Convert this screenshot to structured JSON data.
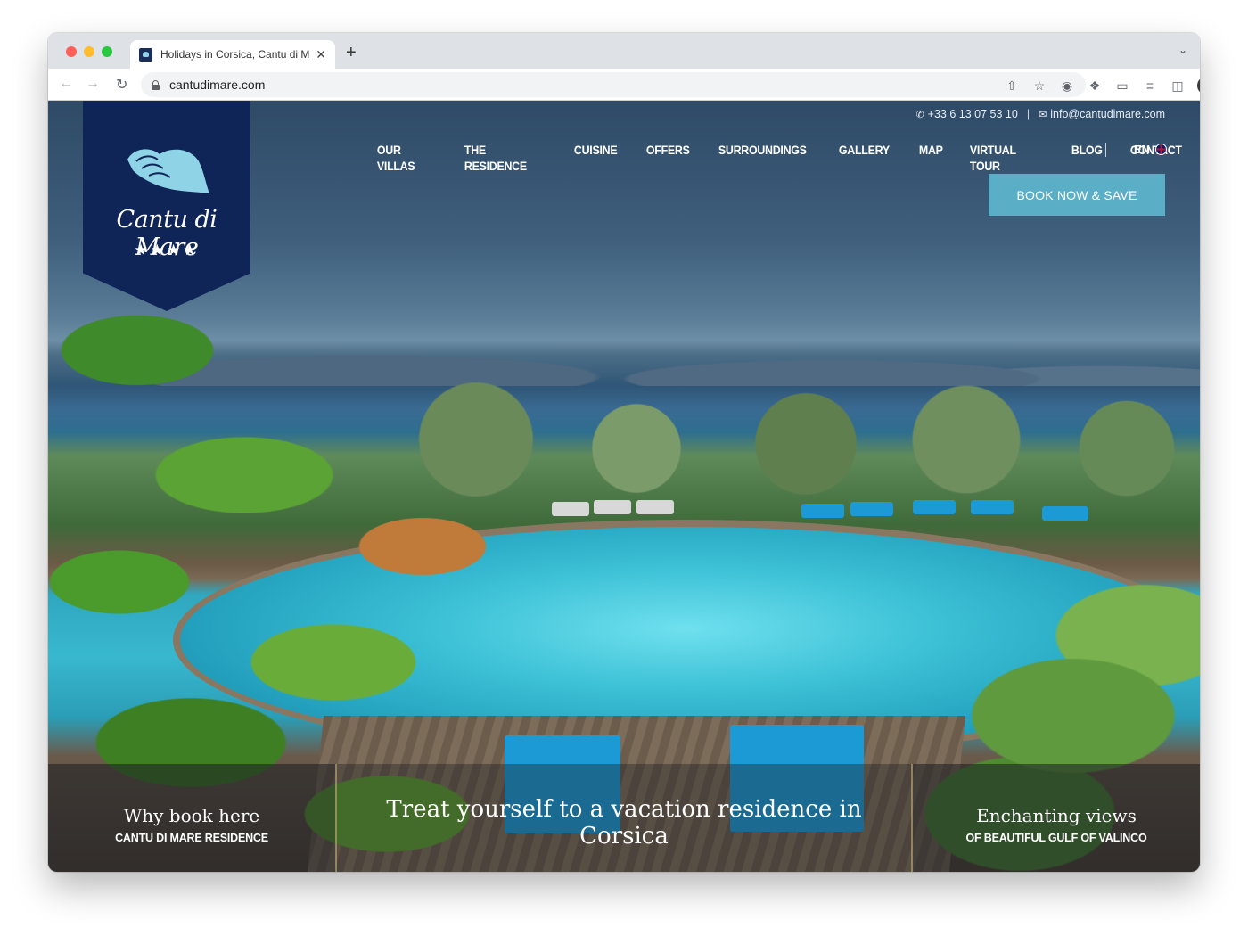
{
  "browser": {
    "tab_title": "Holidays in Corsica, Cantu di M",
    "tab_close": "✕",
    "new_tab": "+",
    "url": "cantudimare.com",
    "colors": {
      "tabstrip": "#dee1e6",
      "red": "#ff5f57",
      "yellow": "#febc2e",
      "green": "#28c840"
    }
  },
  "site": {
    "brand": {
      "name": "Cantu di Mare",
      "stars": "★★★★",
      "color": "#0f2557"
    },
    "contact": {
      "phone": "+33 6 13 07 53 10",
      "separator": "|",
      "email": "info@cantudimare.com"
    },
    "nav": [
      {
        "label": "OUR VILLAS"
      },
      {
        "label": "THE RESIDENCE"
      },
      {
        "label": "CUISINE"
      },
      {
        "label": "OFFERS"
      },
      {
        "label": "SURROUNDINGS"
      },
      {
        "label": "GALLERY"
      },
      {
        "label": "MAP"
      },
      {
        "label": "VIRTUAL TOUR"
      },
      {
        "label": "BLOG"
      },
      {
        "label": "CONTACT"
      }
    ],
    "language": "EN",
    "book_button": {
      "label": "BOOK NOW & SAVE",
      "color": "#5aaec6"
    },
    "panels": {
      "left": {
        "title": "Why book here",
        "subtitle": "CANTU DI MARE RESIDENCE"
      },
      "center": {
        "headline": "Treat yourself to a vacation residence in Corsica"
      },
      "right": {
        "title": "Enchanting views",
        "subtitle": "OF BEAUTIFUL GULF OF VALINCO"
      }
    }
  }
}
